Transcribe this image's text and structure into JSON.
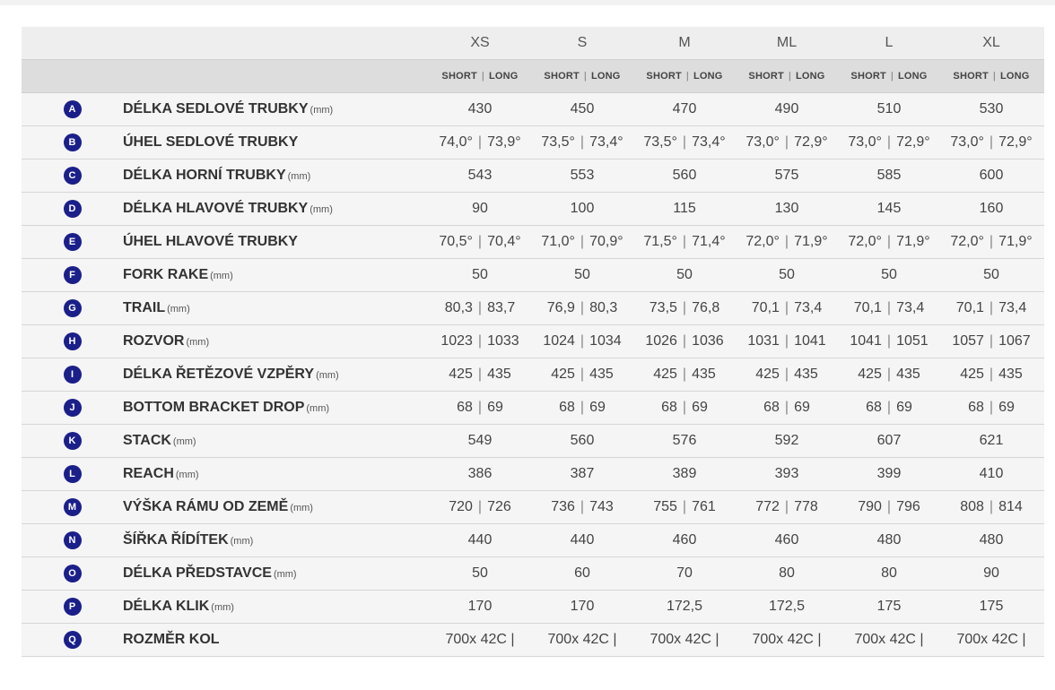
{
  "sizes": [
    "XS",
    "S",
    "M",
    "ML",
    "L",
    "XL"
  ],
  "sub_labels": {
    "short": "SHORT",
    "long": "LONG"
  },
  "rows": [
    {
      "letter": "A",
      "name": "DÉLKA SEDLOVÉ TRUBKY",
      "unit": "(mm)",
      "values": [
        "430",
        "450",
        "470",
        "490",
        "510",
        "530"
      ]
    },
    {
      "letter": "B",
      "name": "ÚHEL SEDLOVÉ TRUBKY",
      "unit": "",
      "values": [
        [
          "74,0°",
          "73,9°"
        ],
        [
          "73,5°",
          "73,4°"
        ],
        [
          "73,5°",
          "73,4°"
        ],
        [
          "73,0°",
          "72,9°"
        ],
        [
          "73,0°",
          "72,9°"
        ],
        [
          "73,0°",
          "72,9°"
        ]
      ]
    },
    {
      "letter": "C",
      "name": "DÉLKA HORNÍ TRUBKY",
      "unit": "(mm)",
      "values": [
        "543",
        "553",
        "560",
        "575",
        "585",
        "600"
      ]
    },
    {
      "letter": "D",
      "name": "DÉLKA HLAVOVÉ TRUBKY",
      "unit": "(mm)",
      "values": [
        "90",
        "100",
        "115",
        "130",
        "145",
        "160"
      ]
    },
    {
      "letter": "E",
      "name": "ÚHEL HLAVOVÉ TRUBKY",
      "unit": "",
      "values": [
        [
          "70,5°",
          "70,4°"
        ],
        [
          "71,0°",
          "70,9°"
        ],
        [
          "71,5°",
          "71,4°"
        ],
        [
          "72,0°",
          "71,9°"
        ],
        [
          "72,0°",
          "71,9°"
        ],
        [
          "72,0°",
          "71,9°"
        ]
      ]
    },
    {
      "letter": "F",
      "name": "FORK RAKE",
      "unit": "(mm)",
      "values": [
        "50",
        "50",
        "50",
        "50",
        "50",
        "50"
      ]
    },
    {
      "letter": "G",
      "name": "TRAIL",
      "unit": "(mm)",
      "values": [
        [
          "80,3",
          "83,7"
        ],
        [
          "76,9",
          "80,3"
        ],
        [
          "73,5",
          "76,8"
        ],
        [
          "70,1",
          "73,4"
        ],
        [
          "70,1",
          "73,4"
        ],
        [
          "70,1",
          "73,4"
        ]
      ]
    },
    {
      "letter": "H",
      "name": "ROZVOR",
      "unit": "(mm)",
      "values": [
        [
          "1023",
          "1033"
        ],
        [
          "1024",
          "1034"
        ],
        [
          "1026",
          "1036"
        ],
        [
          "1031",
          "1041"
        ],
        [
          "1041",
          "1051"
        ],
        [
          "1057",
          "1067"
        ]
      ]
    },
    {
      "letter": "I",
      "name": "DÉLKA ŘETĚZOVÉ VZPĚRY",
      "unit": "(mm)",
      "values": [
        [
          "425",
          "435"
        ],
        [
          "425",
          "435"
        ],
        [
          "425",
          "435"
        ],
        [
          "425",
          "435"
        ],
        [
          "425",
          "435"
        ],
        [
          "425",
          "435"
        ]
      ]
    },
    {
      "letter": "J",
      "name": "BOTTOM BRACKET DROP",
      "unit": "(mm)",
      "values": [
        [
          "68",
          "69"
        ],
        [
          "68",
          "69"
        ],
        [
          "68",
          "69"
        ],
        [
          "68",
          "69"
        ],
        [
          "68",
          "69"
        ],
        [
          "68",
          "69"
        ]
      ]
    },
    {
      "letter": "K",
      "name": "STACK",
      "unit": "(mm)",
      "values": [
        "549",
        "560",
        "576",
        "592",
        "607",
        "621"
      ]
    },
    {
      "letter": "L",
      "name": "REACH",
      "unit": "(mm)",
      "values": [
        "386",
        "387",
        "389",
        "393",
        "399",
        "410"
      ]
    },
    {
      "letter": "M",
      "name": "VÝŠKA RÁMU OD ZEMĚ",
      "unit": "(mm)",
      "values": [
        [
          "720",
          "726"
        ],
        [
          "736",
          "743"
        ],
        [
          "755",
          "761"
        ],
        [
          "772",
          "778"
        ],
        [
          "790",
          "796"
        ],
        [
          "808",
          "814"
        ]
      ]
    },
    {
      "letter": "N",
      "name": "ŠÍŘKA ŘÍDÍTEK",
      "unit": "(mm)",
      "values": [
        "440",
        "440",
        "460",
        "460",
        "480",
        "480"
      ]
    },
    {
      "letter": "O",
      "name": "DÉLKA PŘEDSTAVCE",
      "unit": "(mm)",
      "values": [
        "50",
        "60",
        "70",
        "80",
        "80",
        "90"
      ]
    },
    {
      "letter": "P",
      "name": "DÉLKA KLIK",
      "unit": "(mm)",
      "values": [
        "170",
        "170",
        "172,5",
        "172,5",
        "175",
        "175"
      ]
    },
    {
      "letter": "Q",
      "name": "ROZMĚR KOL",
      "unit": "",
      "values": [
        "700x 42C |",
        "700x 42C |",
        "700x 42C |",
        "700x 42C |",
        "700x 42C |",
        "700x 42C |"
      ]
    }
  ],
  "colors": {
    "badge": "#1a1f8a",
    "header_bg": "#eeeeee",
    "subheader_bg": "#dddddd",
    "row_bg": "#f5f5f5"
  }
}
